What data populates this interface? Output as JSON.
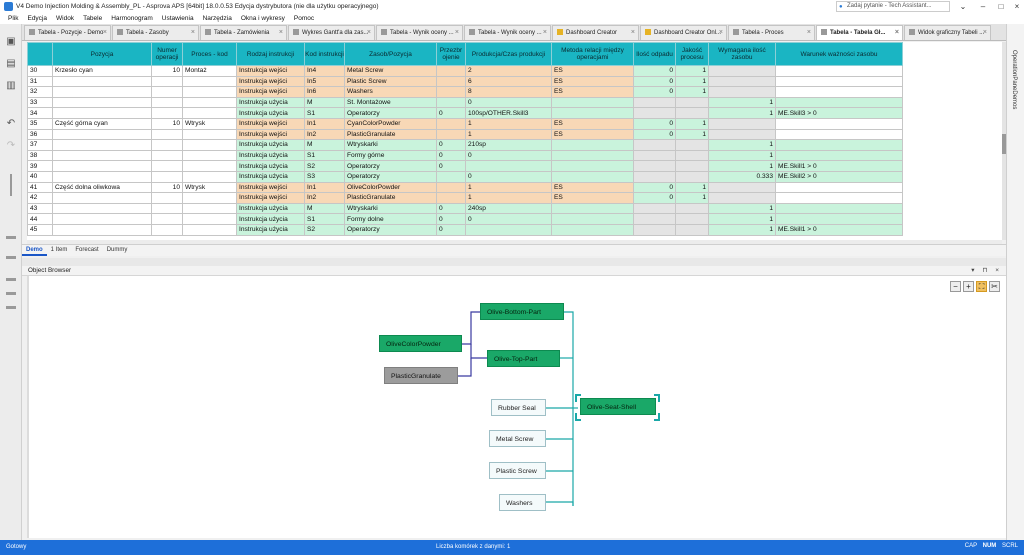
{
  "window": {
    "title": "V4 Demo Injection Molding & Assembly_PL - Asprova APS [64bit] 18.0.0.53 Edycja dystrybutora (nie dla użytku operacyjnego)",
    "ask_placeholder": "Zadaj pytanie - Tech Assistant..."
  },
  "menu": [
    "Plik",
    "Edycja",
    "Widok",
    "Tabele",
    "Harmonogram",
    "Ustawienia",
    "Narzędzia",
    "Okna i wykresy",
    "Pomoc"
  ],
  "tabs": [
    {
      "label": "Tabela - Pozycje - Demo",
      "active": false,
      "icon": "table-icon"
    },
    {
      "label": "Tabela - Zasoby",
      "active": false,
      "icon": "table-icon"
    },
    {
      "label": "Tabela - Zamówienia",
      "active": false,
      "icon": "table-icon"
    },
    {
      "label": "Wykres Gantt'a dla zas...",
      "active": false,
      "icon": "gantt-icon"
    },
    {
      "label": "Tabela - Wynik oceny ...",
      "active": false,
      "icon": "table-icon"
    },
    {
      "label": "Tabela - Wynik oceny ...",
      "active": false,
      "icon": "table-icon"
    },
    {
      "label": "Dashboard Creator",
      "active": false,
      "icon": "dashboard-icon"
    },
    {
      "label": "Dashboard Creator Onl...",
      "active": false,
      "icon": "dashboard-icon"
    },
    {
      "label": "Tabela - Proces",
      "active": false,
      "icon": "table-icon"
    },
    {
      "label": "Tabela - Tabela Gł...",
      "active": true,
      "icon": "table-icon"
    },
    {
      "label": "Widok graficzny Tabeli ...",
      "active": false,
      "icon": "table-icon"
    }
  ],
  "right_panel_label": "OperationPaneDemos",
  "grid": {
    "columns": [
      "Pozycja",
      "Numer operacji",
      "Proces - kod",
      "Rodzaj instrukcji",
      "Kod instrukcji",
      "Zasob/Pozycja",
      "Przezbr ojenie",
      "Produkcja/Czas produkcji",
      "Metoda relacji między operacjami",
      "Ilość odpadu",
      "Jakość procesu",
      "Wymagana ilość zasobu",
      "Warunek ważności zasobu"
    ],
    "rows": [
      {
        "n": "30",
        "item": "Krzesło cyan",
        "op": "10",
        "proc": "Montaż",
        "type": "Instrukcja wejści",
        "code": "In4",
        "res": "Metal Screw",
        "setup": "",
        "prod": "2",
        "rel": "ES",
        "scrap": "0",
        "qual": "1",
        "req": "",
        "cond": "",
        "kind": "in"
      },
      {
        "n": "31",
        "item": "",
        "op": "",
        "proc": "",
        "type": "Instrukcja wejści",
        "code": "In5",
        "res": "Plastic Screw",
        "setup": "",
        "prod": "6",
        "rel": "ES",
        "scrap": "0",
        "qual": "1",
        "req": "",
        "cond": "",
        "kind": "in"
      },
      {
        "n": "32",
        "item": "",
        "op": "",
        "proc": "",
        "type": "Instrukcja wejści",
        "code": "In6",
        "res": "Washers",
        "setup": "",
        "prod": "8",
        "rel": "ES",
        "scrap": "0",
        "qual": "1",
        "req": "",
        "cond": "",
        "kind": "in"
      },
      {
        "n": "33",
        "item": "",
        "op": "",
        "proc": "",
        "type": "Instrukcja użycia",
        "code": "M",
        "res": "St. Montażowe",
        "setup": "",
        "prod": "0",
        "rel": "",
        "scrap": "",
        "qual": "",
        "req": "1",
        "cond": "",
        "kind": "use"
      },
      {
        "n": "34",
        "item": "",
        "op": "",
        "proc": "",
        "type": "Instrukcja użycia",
        "code": "S1",
        "res": "Operatorzy",
        "setup": "0",
        "prod": "100sp/OTHER.Skill3",
        "rel": "",
        "scrap": "",
        "qual": "",
        "req": "1",
        "cond": "ME.Skill3 > 0",
        "kind": "use"
      },
      {
        "n": "35",
        "item": "Część górna cyan",
        "op": "10",
        "proc": "Wtrysk",
        "type": "Instrukcja wejści",
        "code": "In1",
        "res": "CyanColorPowder",
        "setup": "",
        "prod": "1",
        "rel": "ES",
        "scrap": "0",
        "qual": "1",
        "req": "",
        "cond": "",
        "kind": "in"
      },
      {
        "n": "36",
        "item": "",
        "op": "",
        "proc": "",
        "type": "Instrukcja wejści",
        "code": "In2",
        "res": "PlasticGranulate",
        "setup": "",
        "prod": "1",
        "rel": "ES",
        "scrap": "0",
        "qual": "1",
        "req": "",
        "cond": "",
        "kind": "in"
      },
      {
        "n": "37",
        "item": "",
        "op": "",
        "proc": "",
        "type": "Instrukcja użycia",
        "code": "M",
        "res": "Wtryskarki",
        "setup": "0",
        "prod": "210sp",
        "rel": "",
        "scrap": "",
        "qual": "",
        "req": "1",
        "cond": "",
        "kind": "use"
      },
      {
        "n": "38",
        "item": "",
        "op": "",
        "proc": "",
        "type": "Instrukcja użycia",
        "code": "S1",
        "res": "Formy górne",
        "setup": "0",
        "prod": "0",
        "rel": "",
        "scrap": "",
        "qual": "",
        "req": "1",
        "cond": "",
        "kind": "use"
      },
      {
        "n": "39",
        "item": "",
        "op": "",
        "proc": "",
        "type": "Instrukcja użycia",
        "code": "S2",
        "res": "Operatorzy",
        "setup": "0",
        "prod": "",
        "rel": "",
        "scrap": "",
        "qual": "",
        "req": "1",
        "cond": "ME.Skill1 > 0",
        "kind": "use"
      },
      {
        "n": "40",
        "item": "",
        "op": "",
        "proc": "",
        "type": "Instrukcja użycia",
        "code": "S3",
        "res": "Operatorzy",
        "setup": "",
        "prod": "0",
        "rel": "",
        "scrap": "",
        "qual": "",
        "req": "0.333",
        "cond": "ME.Skill2 > 0",
        "kind": "use"
      },
      {
        "n": "41",
        "item": "Część dolna oliwkowa",
        "op": "10",
        "proc": "Wtrysk",
        "type": "Instrukcja wejści",
        "code": "In1",
        "res": "OliveColorPowder",
        "setup": "",
        "prod": "1",
        "rel": "ES",
        "scrap": "0",
        "qual": "1",
        "req": "",
        "cond": "",
        "kind": "in"
      },
      {
        "n": "42",
        "item": "",
        "op": "",
        "proc": "",
        "type": "Instrukcja wejści",
        "code": "In2",
        "res": "PlasticGranulate",
        "setup": "",
        "prod": "1",
        "rel": "ES",
        "scrap": "0",
        "qual": "1",
        "req": "",
        "cond": "",
        "kind": "in"
      },
      {
        "n": "43",
        "item": "",
        "op": "",
        "proc": "",
        "type": "Instrukcja użycia",
        "code": "M",
        "res": "Wtryskarki",
        "setup": "0",
        "prod": "240sp",
        "rel": "",
        "scrap": "",
        "qual": "",
        "req": "1",
        "cond": "",
        "kind": "use"
      },
      {
        "n": "44",
        "item": "",
        "op": "",
        "proc": "",
        "type": "Instrukcja użycia",
        "code": "S1",
        "res": "Formy dolne",
        "setup": "0",
        "prod": "0",
        "rel": "",
        "scrap": "",
        "qual": "",
        "req": "1",
        "cond": "",
        "kind": "use"
      },
      {
        "n": "45",
        "item": "",
        "op": "",
        "proc": "",
        "type": "Instrukcja użycia",
        "code": "S2",
        "res": "Operatorzy",
        "setup": "0",
        "prod": "",
        "rel": "",
        "scrap": "",
        "qual": "",
        "req": "1",
        "cond": "ME.Skill1 > 0",
        "kind": "use"
      }
    ]
  },
  "sheet_tabs": [
    "Demo",
    "1 Item",
    "Forecast",
    "Dummy"
  ],
  "object_browser": {
    "title": "Object Browser",
    "controls": [
      "▾",
      "⊓",
      "×"
    ],
    "zoom_controls": [
      "−",
      "+",
      "⛶",
      "✂"
    ],
    "nodes": {
      "olive_bottom_part": "Olive-Bottom-Part",
      "olive_color_powder": "OliveColorPowder",
      "olive_top_part": "Olive-Top-Part",
      "plastic_granulate": "PlasticGranulate",
      "rubber_seal": "Rubber Seal",
      "olive_seat_shell": "Olive-Seat-Shell",
      "metal_screw": "Metal Screw",
      "plastic_screw": "Plastic Screw",
      "washers": "Washers"
    }
  },
  "status": {
    "ready": "Gotowy",
    "cells": "Liczba komórek z danymi: 1",
    "keys": [
      "CAP",
      "NUM",
      "SCRL"
    ]
  },
  "colors": {
    "header": "#1ab5c3",
    "input_row": "#f8d8b6",
    "use_row": "#c9f3dc",
    "node_green": "#1aa868",
    "statusbar": "#1e6fd9"
  }
}
